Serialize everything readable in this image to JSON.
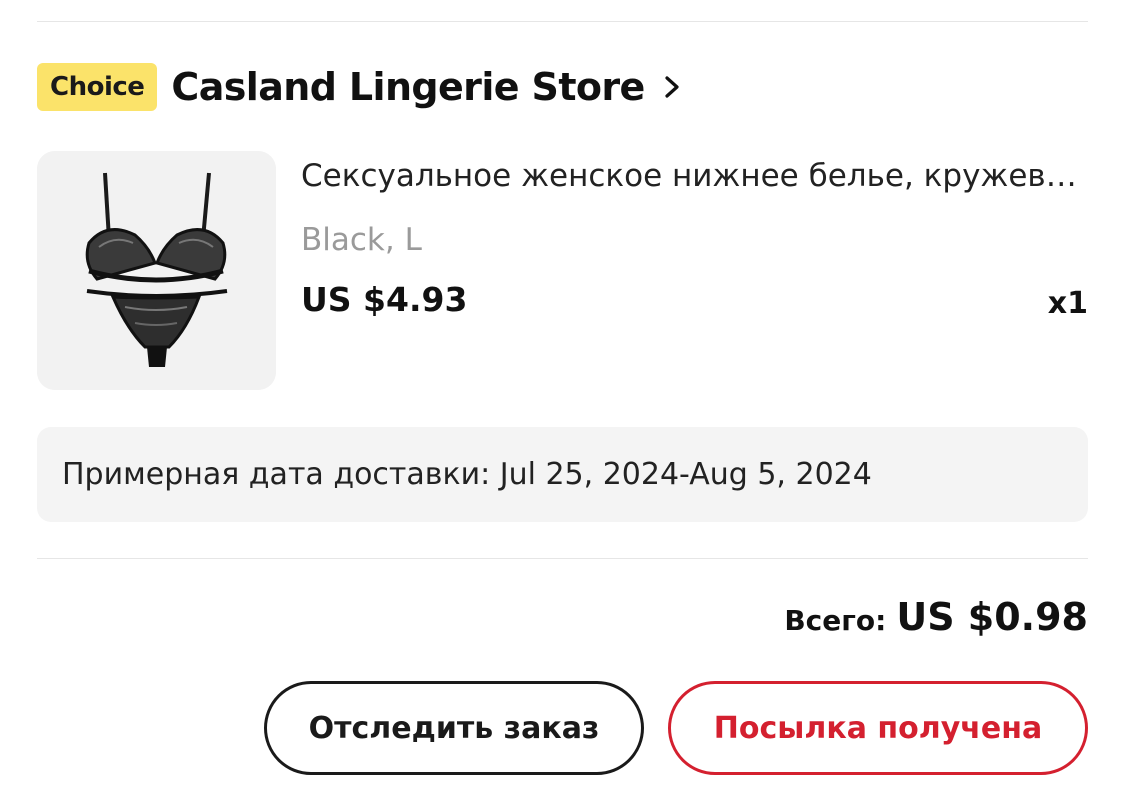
{
  "store": {
    "badge": "Choice",
    "name": "Casland Lingerie Store",
    "icon": "chevron-right-icon"
  },
  "product": {
    "title": "Сексуальное женское нижнее белье, кружевное",
    "variant": "Black, L",
    "price": "US $4.93",
    "quantity": "x1",
    "image": "lingerie-product-thumbnail"
  },
  "delivery": {
    "text": "Примерная дата доставки: Jul 25, 2024-Aug 5, 2024"
  },
  "total": {
    "label": "Всего:",
    "value": "US $0.98"
  },
  "actions": {
    "track_label": "Отследить заказ",
    "received_label": "Посылка получена"
  },
  "colors": {
    "badge_bg": "#fbe36a",
    "accent_red": "#d4202f",
    "panel_bg": "#f4f4f4"
  }
}
